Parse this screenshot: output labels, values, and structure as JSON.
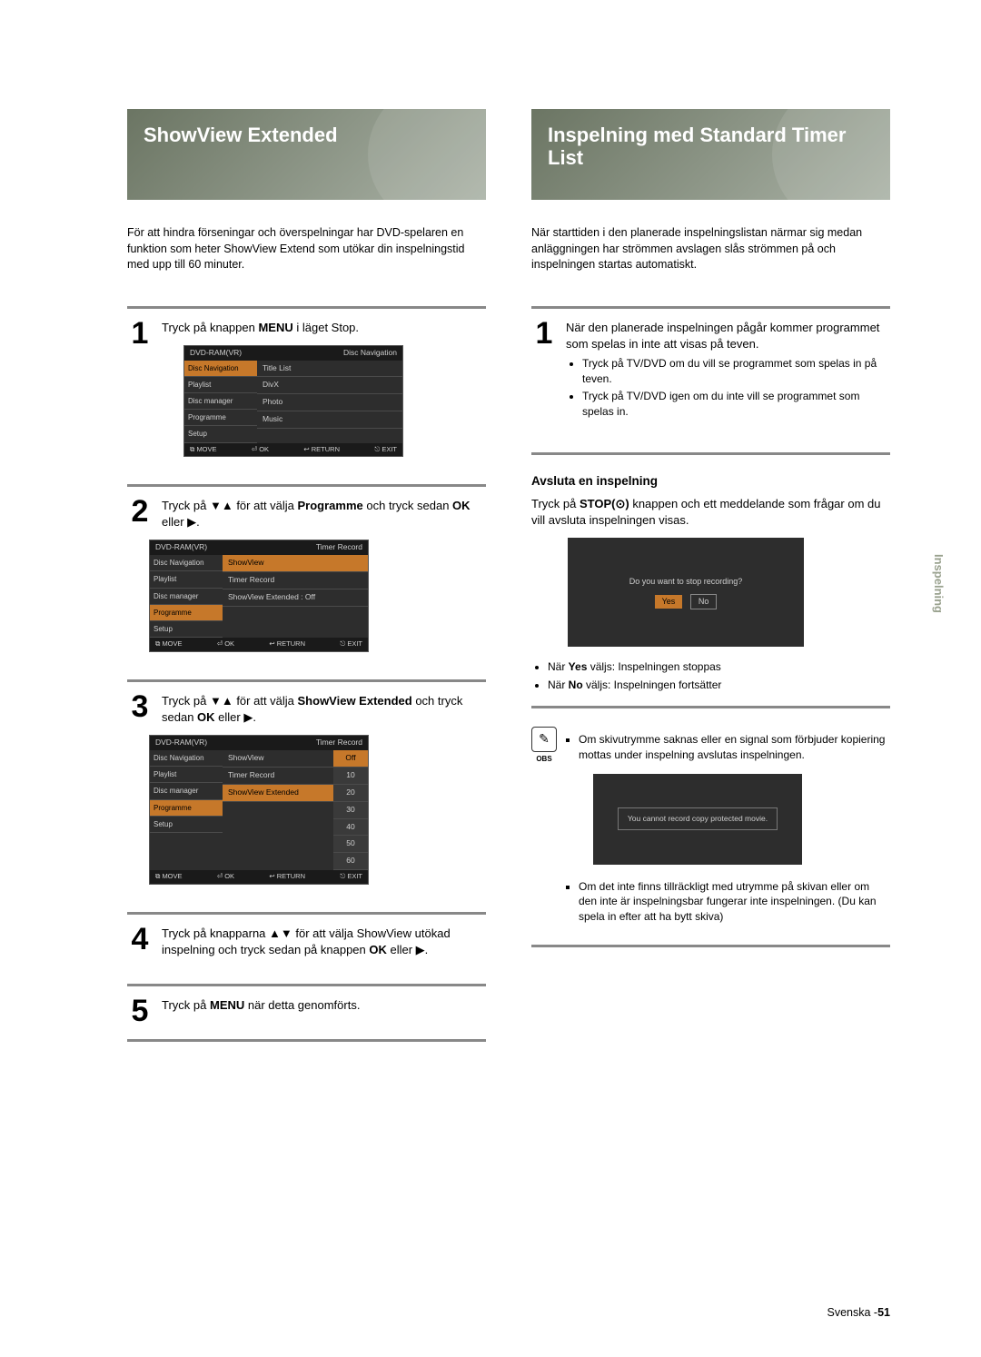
{
  "left": {
    "hero": "ShowView Extended",
    "intro": "För att hindra förseningar och överspelningar har DVD-spelaren en funktion som heter ShowView Extend som utökar din inspelningstid med upp till 60 minuter.",
    "s1": "Tryck på knappen <b>MENU</b> i läget Stop.",
    "s2": "Tryck på ▼▲ för att välja <b>Programme</b> och tryck sedan <b>OK</b> eller ▶.",
    "s3": "Tryck på ▼▲ för att välja <b>ShowView Extended</b> och tryck sedan <b>OK</b> eller ▶.",
    "s4": "Tryck på knapparna ▲▼ för att välja ShowView utökad inspelning och tryck sedan på knappen <b>OK</b> eller ▶.",
    "s5": "Tryck på <b>MENU</b> när detta genomförts."
  },
  "osd1": {
    "top_l": "DVD-RAM(VR)",
    "top_r": "Disc Navigation",
    "side": [
      "Disc Navigation",
      "Playlist",
      "Disc manager",
      "Programme",
      "Setup"
    ],
    "main": [
      "Title List",
      "DivX",
      "Photo",
      "Music"
    ],
    "foot": [
      "⧉ MOVE",
      "⏎ OK",
      "↩ RETURN",
      "⎋ EXIT"
    ]
  },
  "osd2": {
    "top_l": "DVD-RAM(VR)",
    "top_r": "Timer Record",
    "side": [
      "Disc Navigation",
      "Playlist",
      "Disc manager",
      "Programme",
      "Setup"
    ],
    "main": [
      "ShowView",
      "Timer Record",
      "ShowView Extended : Off"
    ]
  },
  "osd3": {
    "top_l": "DVD-RAM(VR)",
    "top_r": "Timer Record",
    "side": [
      "Disc Navigation",
      "Playlist",
      "Disc manager",
      "Programme",
      "Setup"
    ],
    "main": [
      "ShowView",
      "Timer Record",
      "ShowView Extended"
    ],
    "values": [
      "Off",
      "10",
      "20",
      "30",
      "40",
      "50",
      "60"
    ]
  },
  "right": {
    "hero": "Inspelning med Standard Timer List",
    "intro": "När starttiden i den planerade inspelningslistan närmar sig medan anläggningen har strömmen avslagen slås strömmen på och inspelningen startas automatiskt.",
    "s1": "När den planerade inspelningen pågår kommer programmet som spelas in inte att visas på teven.",
    "s1b": [
      "Tryck på TV/DVD om du vill se programmet som spelas in på teven.",
      "Tryck på TV/DVD igen om du inte vill se programmet som spelas in."
    ],
    "sub": "Avsluta en inspelning",
    "stoptext": "Tryck på <b>STOP(⊙)</b> knappen och ett meddelande som frågar om du vill avsluta inspelningen visas.",
    "dlg": {
      "q": "Do you want to stop recording?",
      "yes": "Yes",
      "no": "No"
    },
    "resbul": [
      "När <b>Yes</b> väljs: Inspelningen stoppas",
      "När <b>No</b> väljs: Inspelningen fortsätter"
    ],
    "note": {
      "icon": "✎",
      "label": "OBS"
    },
    "sq1": "Om skivutrymme saknas eller en signal som förbjuder kopiering mottas under inspelning avslutas inspelningen.",
    "err": "You cannot record copy protected movie.",
    "sq2": "Om det inte finns tillräckligt med utrymme på skivan eller om den inte är inspelningsbar fungerar inte inspelningen. (Du kan spela in efter att ha bytt skiva)"
  },
  "sidetab": "Inspelning",
  "footer": {
    "lang": "Svenska -",
    "page": "51"
  }
}
